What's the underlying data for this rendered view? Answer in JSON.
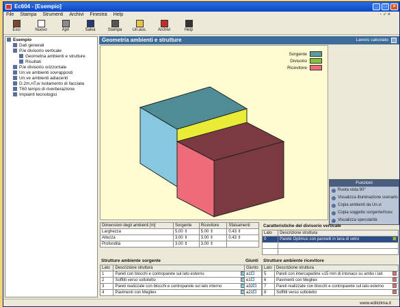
{
  "window": {
    "title": "Ec604 - [Esempio]"
  },
  "menu": {
    "items": [
      "File",
      "Stampa",
      "Strumenti",
      "Archivi",
      "Finestra",
      "Help"
    ],
    "right": "- ♂ ×"
  },
  "toolbar": [
    {
      "label": "Esci",
      "icon": "exit-icon",
      "color": "#7a4a2a"
    },
    {
      "label": "Nuovo",
      "icon": "new-file-icon",
      "color": "#ffffff"
    },
    {
      "label": "Apri",
      "icon": "open-icon",
      "color": "#8a8a8a"
    },
    {
      "label": "Salva",
      "icon": "save-icon",
      "color": "#223a7a"
    },
    {
      "label": "Stampa",
      "icon": "print-icon",
      "color": "#555555"
    },
    {
      "label": "Un.aus.",
      "icon": "folder-icon",
      "color": "#e8c34a"
    },
    {
      "label": "Archivi",
      "icon": "archive-icon",
      "color": "#c0302a"
    },
    {
      "label": "Help",
      "icon": "help-icon",
      "color": "#333333"
    }
  ],
  "tree": [
    {
      "label": "Esempio",
      "level": 0
    },
    {
      "label": "Dati generali",
      "level": 1
    },
    {
      "label": "P.le divisorio verticale",
      "level": 1
    },
    {
      "label": "Geometria ambienti e strutture",
      "level": 2
    },
    {
      "label": "Risultati",
      "level": 2
    },
    {
      "label": "P.le divisorio orizzontale",
      "level": 1
    },
    {
      "label": "Un.ve ambienti sovrapposti",
      "level": 1
    },
    {
      "label": "Un.ve ambienti adiacenti",
      "level": 1
    },
    {
      "label": "D.2m,nT,w isolamento di facciata",
      "level": 1
    },
    {
      "label": "T60 tempo di riverberazione",
      "level": 1
    },
    {
      "label": "Impianti tecnologici",
      "level": 1
    }
  ],
  "panel": {
    "title": "Geometria ambienti e strutture",
    "right_label": "Lavoro calcolato"
  },
  "legend": [
    {
      "label": "Sorgente",
      "color": "#5d9ca0"
    },
    {
      "label": "Divisorio",
      "color": "#7fc33f"
    },
    {
      "label": "Ricevitore",
      "color": "#ee6c79"
    }
  ],
  "funzioni": {
    "title": "Funzioni",
    "items": [
      "Ruota vista 90°",
      "Visualizza illuminazione scenario",
      "Copia ambienti da Un.vi",
      "Copia soggetto sorgente/ricev.",
      "Visualizza specularità"
    ]
  },
  "dim_table": {
    "headers": [
      "Dimensioni degli ambienti [m]",
      "Sorgente",
      "Ricevitore",
      "Sfalsamenti"
    ],
    "rows": [
      {
        "label": "Larghezza",
        "sorg": "5.00",
        "ric": "5.00",
        "sfal": "0.43"
      },
      {
        "label": "Altezza",
        "sorg": "3.00",
        "ric": "3.00",
        "sfal": "0.43"
      },
      {
        "label": "Profondità",
        "sorg": "3.00",
        "ric": "3.00",
        "sfal": ""
      }
    ]
  },
  "caratteristiche": {
    "title": "Caratteristiche del divisorio verticale",
    "headers": [
      "Lato",
      "Descrizione struttura"
    ],
    "rows": [
      {
        "lato": "0",
        "desc": "Parete Optimus con pannelli in lana di vetro"
      }
    ]
  },
  "sorgente": {
    "title": "Strutture ambiente sorgente",
    "headers": [
      "Lato",
      "Descrizione struttura"
    ],
    "rows": [
      {
        "lato": "1",
        "desc": "Pareti con blocchi e controparete sul lato esterno"
      },
      {
        "lato": "2",
        "desc": "Soffitti verso sottotetto"
      },
      {
        "lato": "3",
        "desc": "Pareti realizzate con blocchi e controparete sul lato interno"
      },
      {
        "lato": "4",
        "desc": "Pavimenti con Megliex"
      }
    ]
  },
  "giunti": {
    "title": "Giunti",
    "header": "Giunto",
    "rows": [
      "a1",
      "e1",
      "a32",
      "a21"
    ]
  },
  "ricevente": {
    "title": "Strutture ambiente ricevitore",
    "headers": [
      "Lato",
      "Descrizione struttura"
    ],
    "rows": [
      {
        "lato": "5",
        "desc": "Pareti con intercapedine ≥15 mm di intonaco su ambo i lati"
      },
      {
        "lato": "6",
        "desc": "Pavimenti con Megliex"
      },
      {
        "lato": "7",
        "desc": "Pareti realizzate con blocchi e controparete sul lato esterno"
      },
      {
        "lato": "8",
        "desc": "Soffitti verso sottotetto"
      }
    ]
  },
  "status": {
    "right": "www.edilclima.it"
  }
}
